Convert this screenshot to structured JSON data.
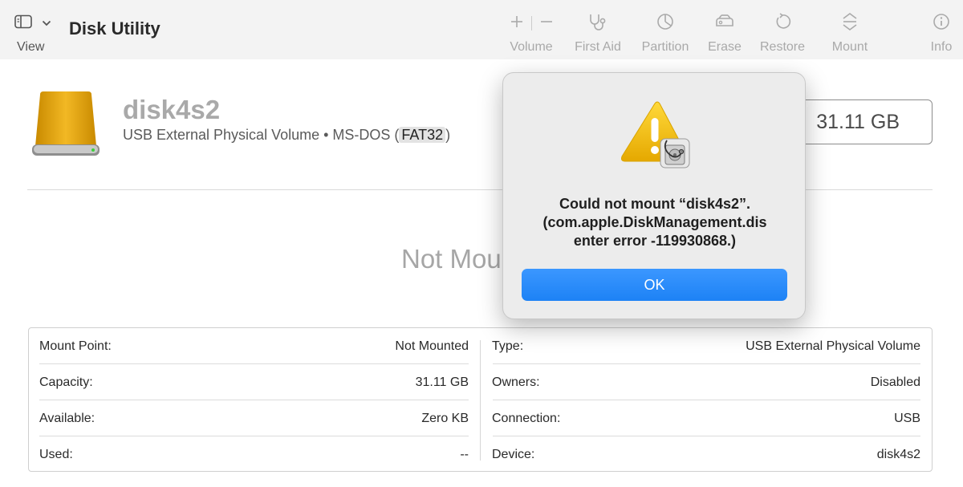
{
  "app": {
    "title": "Disk Utility"
  },
  "toolbar": {
    "view_label": "View",
    "buttons": {
      "volume": "Volume",
      "first_aid": "First Aid",
      "partition": "Partition",
      "erase": "Erase",
      "restore": "Restore",
      "mount": "Mount",
      "info": "Info"
    }
  },
  "volume": {
    "name": "disk4s2",
    "desc_prefix": "USB External Physical Volume • MS-DOS (",
    "fs": "FAT32",
    "desc_suffix": ")",
    "size": "31.11 GB",
    "status": "Not Mounted"
  },
  "info": {
    "left": [
      {
        "label": "Mount Point:",
        "value": "Not Mounted"
      },
      {
        "label": "Capacity:",
        "value": "31.11 GB"
      },
      {
        "label": "Available:",
        "value": "Zero KB"
      },
      {
        "label": "Used:",
        "value": "--"
      }
    ],
    "right": [
      {
        "label": "Type:",
        "value": "USB External Physical Volume"
      },
      {
        "label": "Owners:",
        "value": "Disabled"
      },
      {
        "label": "Connection:",
        "value": "USB"
      },
      {
        "label": "Device:",
        "value": "disk4s2"
      }
    ]
  },
  "alert": {
    "message": "Could not mount “disk4s2”. (com.apple.DiskManagement.disenter error -119930868.)",
    "line1": "Could not mount “disk4s2”.",
    "line2": "(com.apple.DiskManagement.dis",
    "line3": "enter error -119930868.)",
    "ok_label": "OK"
  },
  "colors": {
    "accent": "#1d82f5",
    "warning": "#f4c20d"
  },
  "icons": [
    "sidebar-icon",
    "chevron-down-icon",
    "plus-icon",
    "minus-icon",
    "stethoscope-icon",
    "pie-chart-icon",
    "eraser-icon",
    "restore-icon",
    "mount-icon",
    "info-icon",
    "drive-icon",
    "warning-icon",
    "disk-utility-badge-icon"
  ]
}
